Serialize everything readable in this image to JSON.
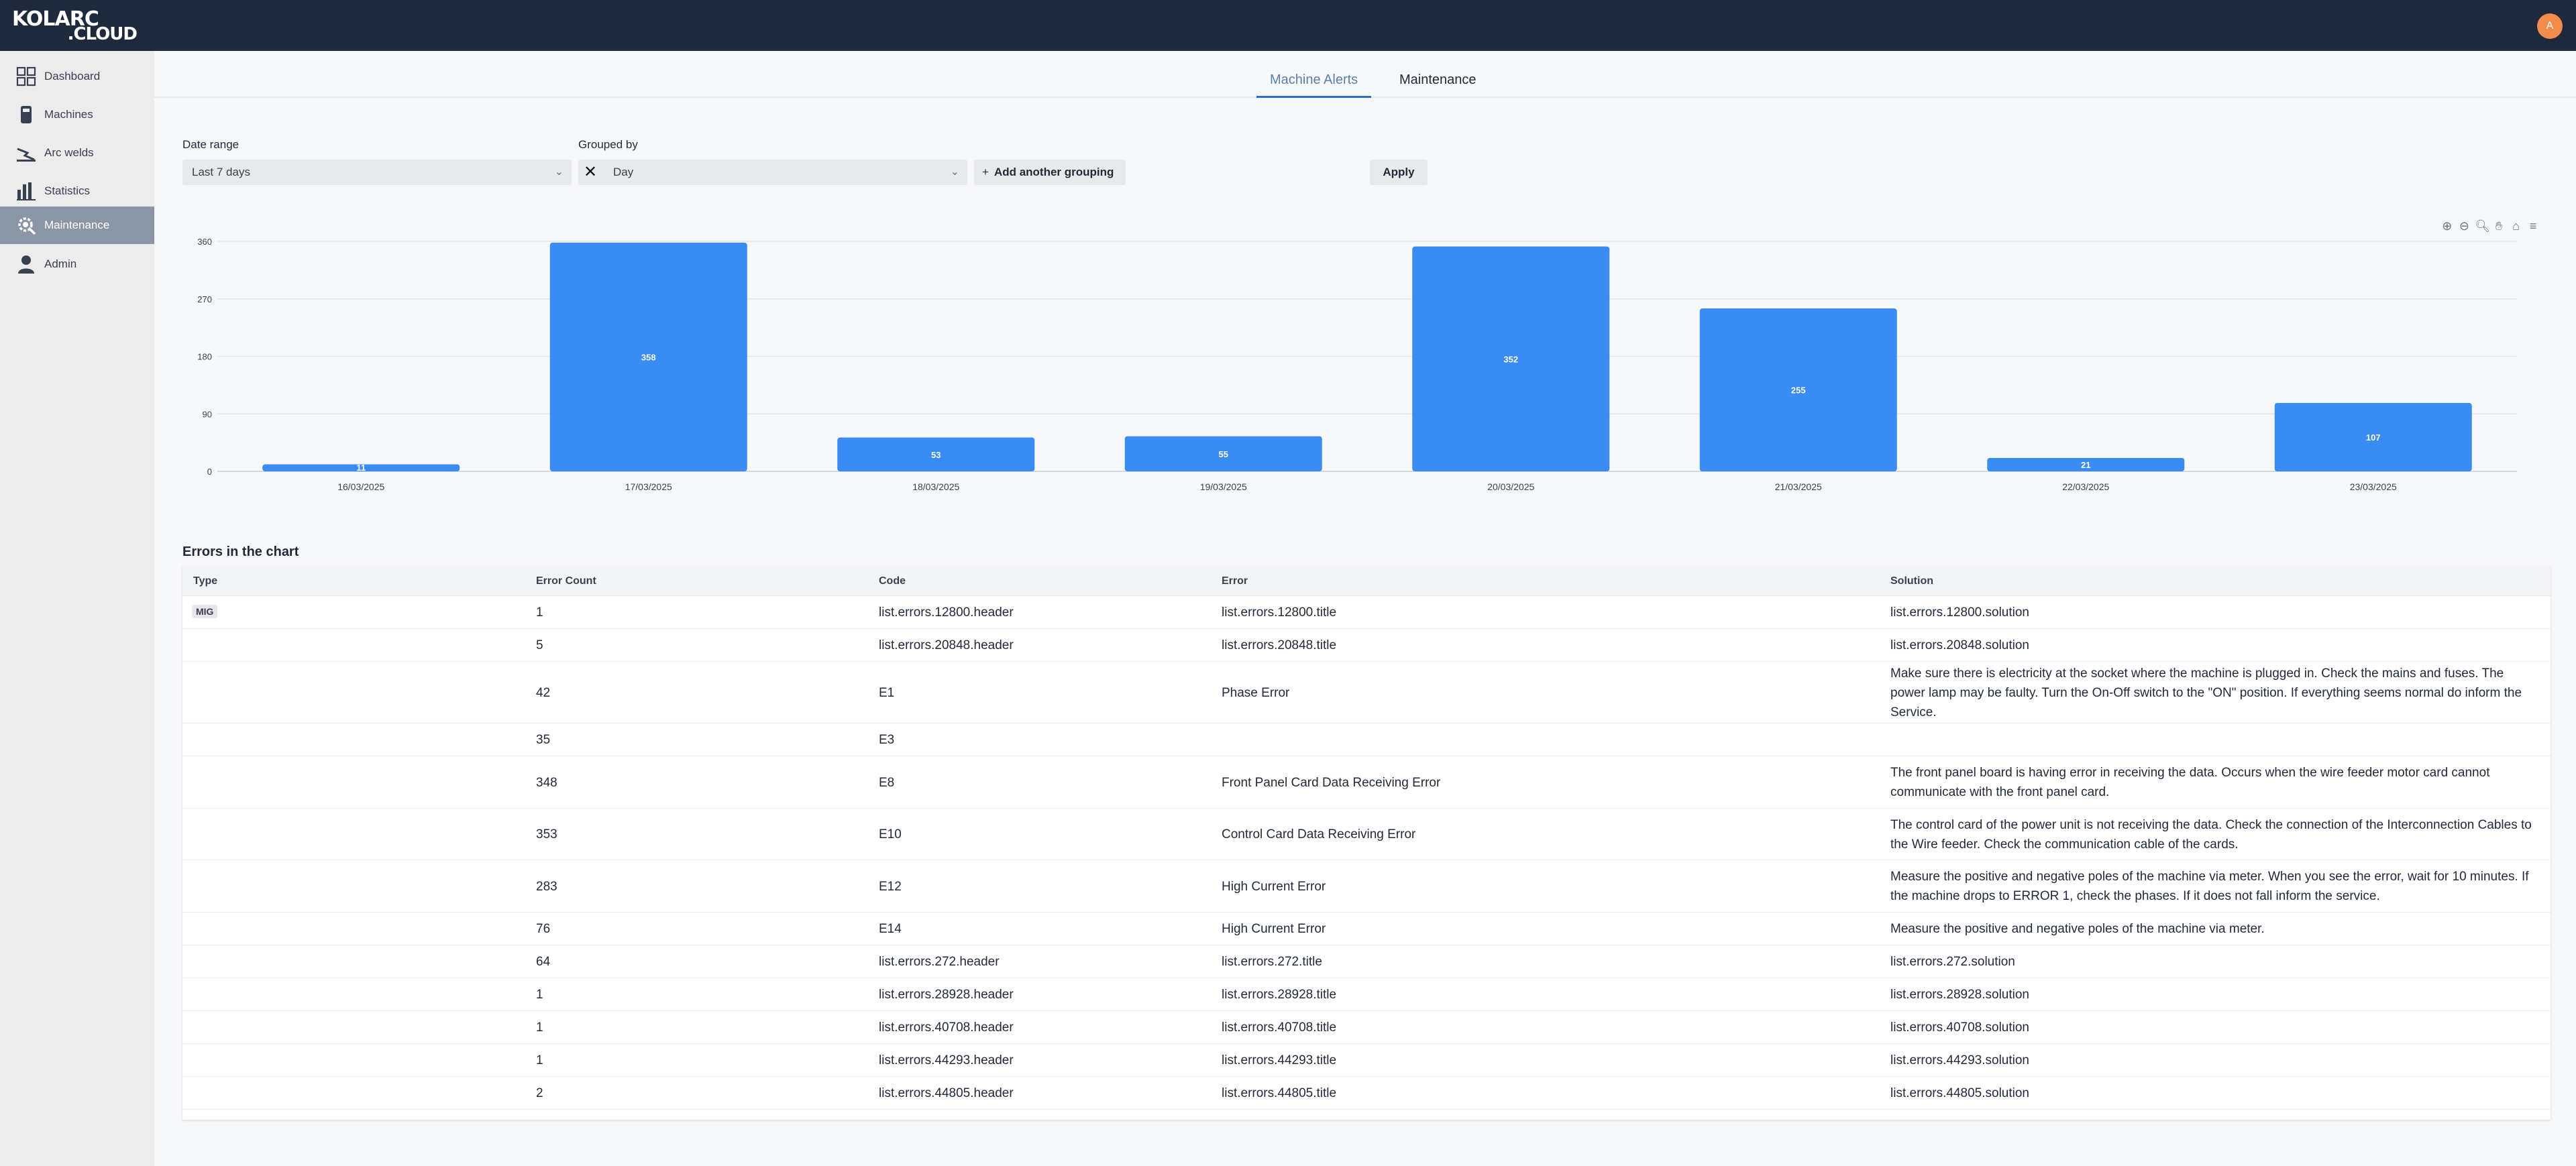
{
  "app": {
    "logo_line1": "KOLARC",
    "logo_line2": ".CLOUD",
    "avatar_initial": "A"
  },
  "sidebar": {
    "items": [
      {
        "label": "Dashboard",
        "icon": "dashboard-icon"
      },
      {
        "label": "Machines",
        "icon": "machine-icon"
      },
      {
        "label": "Arc welds",
        "icon": "arc-weld-icon"
      },
      {
        "label": "Statistics",
        "icon": "statistics-icon"
      },
      {
        "label": "Maintenance",
        "icon": "maintenance-icon",
        "active": true
      },
      {
        "label": "Admin",
        "icon": "admin-icon"
      }
    ]
  },
  "tabs": [
    {
      "label": "Machine Alerts",
      "active": true
    },
    {
      "label": "Maintenance"
    }
  ],
  "filters": {
    "date_range_label": "Date range",
    "date_range_value": "Last 7 days",
    "grouped_by_label": "Grouped by",
    "grouped_by_value": "Day",
    "add_grouping_label": "Add another grouping",
    "apply_label": "Apply"
  },
  "colors": {
    "bar": "#3b8bf5",
    "topbar": "#1e2a3b",
    "active_nav": "#8a95a5"
  },
  "chart_data": {
    "type": "bar",
    "categories": [
      "16/03/2025",
      "17/03/2025",
      "18/03/2025",
      "19/03/2025",
      "20/03/2025",
      "21/03/2025",
      "22/03/2025",
      "23/03/2025"
    ],
    "values": [
      11,
      358,
      53,
      55,
      352,
      255,
      21,
      107
    ],
    "yticks": [
      0,
      90,
      180,
      270,
      360
    ],
    "ylim": [
      0,
      360
    ],
    "grid": true,
    "title": "",
    "xlabel": "",
    "ylabel": ""
  },
  "table": {
    "title": "Errors in the chart",
    "headers": [
      "Type",
      "Error Count",
      "Code",
      "Error",
      "Solution"
    ],
    "rows": [
      {
        "type": "MIG",
        "count": "1",
        "code": "list.errors.12800.header",
        "error": "list.errors.12800.title",
        "solution": "list.errors.12800.solution"
      },
      {
        "type": "",
        "count": "5",
        "code": "list.errors.20848.header",
        "error": "list.errors.20848.title",
        "solution": "list.errors.20848.solution"
      },
      {
        "type": "",
        "count": "42",
        "code": "E1",
        "error": "Phase Error",
        "solution": "Make sure there is electricity at the socket where the machine is plugged in. Check the mains and fuses. The power lamp may be faulty. Turn the On-Off switch to the \"ON\" position. If everything seems normal do inform the Service."
      },
      {
        "type": "",
        "count": "35",
        "code": "E3",
        "error": "",
        "solution": ""
      },
      {
        "type": "",
        "count": "348",
        "code": "E8",
        "error": "Front Panel Card Data Receiving Error",
        "solution": "The front panel board is having error in receiving the data. Occurs when the wire feeder motor card cannot communicate with the front panel card."
      },
      {
        "type": "",
        "count": "353",
        "code": "E10",
        "error": "Control Card Data Receiving Error",
        "solution": "The control card of the power unit is not receiving the data. Check the connection of the Interconnection Cables to the Wire feeder. Check the communication cable of the cards."
      },
      {
        "type": "",
        "count": "283",
        "code": "E12",
        "error": "High Current Error",
        "solution": "Measure the positive and negative poles of the machine via meter. When you see the error, wait for 10 minutes. If the machine drops to ERROR 1, check the phases. If it does not fall inform the service."
      },
      {
        "type": "",
        "count": "76",
        "code": "E14",
        "error": "High Current Error",
        "solution": "Measure the positive and negative poles of the machine via meter."
      },
      {
        "type": "",
        "count": "64",
        "code": "list.errors.272.header",
        "error": "list.errors.272.title",
        "solution": "list.errors.272.solution"
      },
      {
        "type": "",
        "count": "1",
        "code": "list.errors.28928.header",
        "error": "list.errors.28928.title",
        "solution": "list.errors.28928.solution"
      },
      {
        "type": "",
        "count": "1",
        "code": "list.errors.40708.header",
        "error": "list.errors.40708.title",
        "solution": "list.errors.40708.solution"
      },
      {
        "type": "",
        "count": "1",
        "code": "list.errors.44293.header",
        "error": "list.errors.44293.title",
        "solution": "list.errors.44293.solution"
      },
      {
        "type": "",
        "count": "2",
        "code": "list.errors.44805.header",
        "error": "list.errors.44805.title",
        "solution": "list.errors.44805.solution"
      }
    ]
  }
}
